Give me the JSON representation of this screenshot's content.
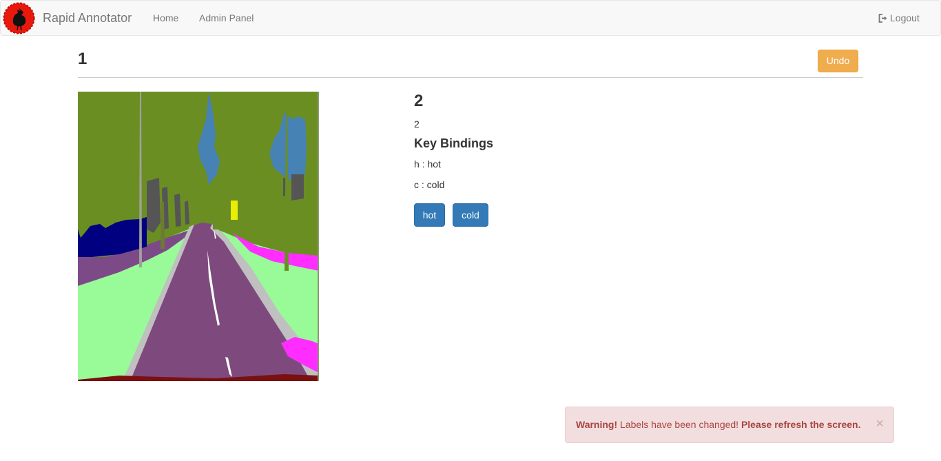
{
  "navbar": {
    "logo_icon": "red-rooster-logo-icon",
    "brand": "Rapid Annotator",
    "links": [
      {
        "label": "Home"
      },
      {
        "label": "Admin Panel"
      }
    ],
    "logout_label": "Logout",
    "logout_icon": "sign-out-icon"
  },
  "header": {
    "title": "1",
    "undo_label": "Undo"
  },
  "image": {
    "kind": "semantic-segmentation-road-scene"
  },
  "panel": {
    "title": "2",
    "value": "2",
    "bindings_title": "Key Bindings",
    "bindings": [
      {
        "text": "h : hot"
      },
      {
        "text": "c : cold"
      }
    ],
    "buttons": [
      {
        "label": "hot"
      },
      {
        "label": "cold"
      }
    ]
  },
  "alert": {
    "strong": "Warning!",
    "message": " Labels have been changed! ",
    "emphasis": "Please refresh the screen.",
    "close": "×"
  },
  "colors": {
    "undo": "#f0ad4e",
    "primary": "#337ab7",
    "alert_bg": "#f2dede",
    "alert_text": "#a94442"
  }
}
